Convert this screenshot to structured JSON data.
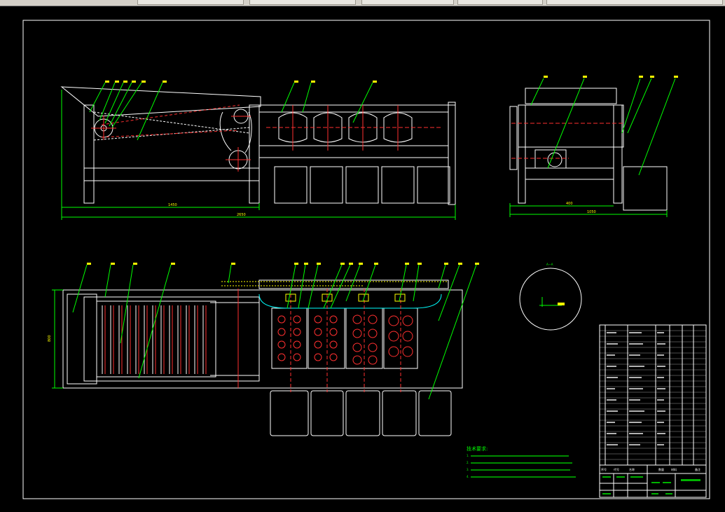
{
  "window": {
    "tabs": [
      "",
      "",
      "",
      "",
      ""
    ]
  },
  "drawing": {
    "dim_front_inner": "1450",
    "dim_front_total": "2650",
    "dim_side_inner": "400",
    "dim_side_total": "1050",
    "dim_plan_height": "800",
    "detail_label": "A—A",
    "notes_title": "技术要求:",
    "note_lines": [
      "1.",
      "2.",
      "3.",
      "4."
    ],
    "title_block": {
      "drawing_name": "",
      "header_cols": [
        "序号",
        "代号",
        "名称",
        "数量",
        "材料",
        "备注"
      ]
    }
  },
  "colors": {
    "background": "#000000",
    "outline": "#ffffff",
    "leader": "#00ff00",
    "centerline": "#ff3030",
    "highlight": "#ffff00",
    "accent": "#00ffff"
  }
}
